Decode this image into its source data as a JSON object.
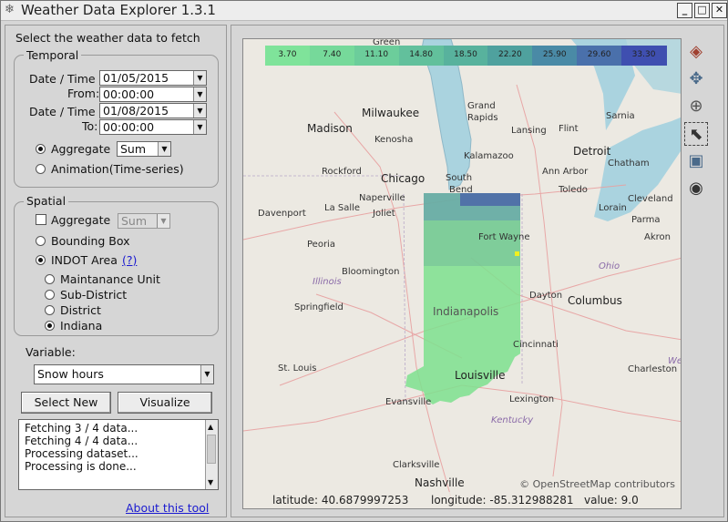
{
  "window": {
    "title": "Weather Data Explorer 1.3.1"
  },
  "left": {
    "heading": "Select the weather data to fetch",
    "temporal": {
      "title": "Temporal",
      "date_label": "Date / Time",
      "start_date": "01/05/2015",
      "from_label": "From:",
      "from_time": "00:00:00",
      "end_date": "01/08/2015",
      "to_label": "To:",
      "to_time": "00:00:00",
      "aggregate_label": "Aggregate",
      "aggregate_value": "Sum",
      "animation_label": "Animation(Time-series)"
    },
    "spatial": {
      "title": "Spatial",
      "aggregate_label": "Aggregate",
      "aggregate_value": "Sum",
      "bbox_label": "Bounding Box",
      "indot_label": "INDOT Area",
      "help_link": "(?)",
      "options": [
        "Maintanance Unit",
        "Sub-District",
        "District",
        "Indiana"
      ]
    },
    "variable_label": "Variable:",
    "variable_value": "Snow hours",
    "select_new": "Select New",
    "visualize": "Visualize",
    "log": [
      "Fetching 3 / 4 data...",
      "Fetching 4 / 4 data...",
      "Processing dataset...",
      "Processing is done..."
    ],
    "about": "About this tool"
  },
  "map": {
    "legend": [
      "3.70",
      "7.40",
      "11.10",
      "14.80",
      "18.50",
      "22.20",
      "25.90",
      "29.60",
      "33.30"
    ],
    "cities": [
      "Green",
      "Milwaukee",
      "Grand",
      "Rapids",
      "Madison",
      "Kenosha",
      "Lansing",
      "Flint",
      "Detroit",
      "Sarnia",
      "Kalamazoo",
      "Chatham",
      "Rockford",
      "Chicago",
      "South",
      "Bend",
      "Ann Arbor",
      "Naperville",
      "Toledo",
      "Cleveland",
      "La Salle",
      "Joliet",
      "Lorain",
      "Parma",
      "Davenport",
      "Fort Wayne",
      "Akron",
      "Peoria",
      "Bloomington",
      "Ohio",
      "Illinois",
      "Springfield",
      "Dayton",
      "Columbus",
      "Indianapolis",
      "Cincinnati",
      "St. Louis",
      "Louisville",
      "Charleston",
      "Kentucky",
      "Lexington",
      "Evansville",
      "Clarksville",
      "Nashville",
      "Wes"
    ],
    "attribution": "© OpenStreetMap contributors",
    "status": {
      "latitude": "latitude: 40.6879997253",
      "longitude": "longitude: -85.312988281",
      "value": "value: 9.0"
    }
  }
}
